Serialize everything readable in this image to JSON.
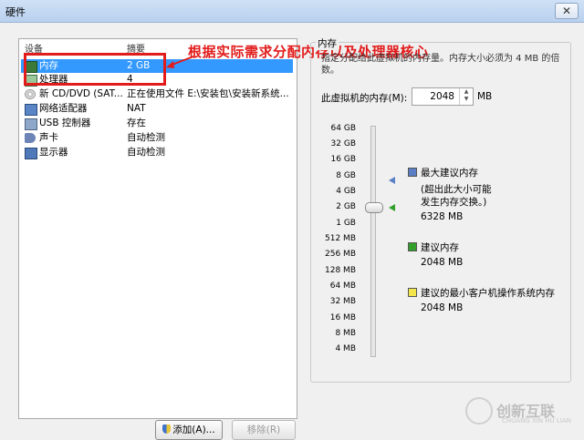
{
  "window": {
    "title": "硬件",
    "close_glyph": "✕"
  },
  "device_list": {
    "col_device": "设备",
    "col_summary": "摘要",
    "rows": [
      {
        "name": "内存",
        "summary": "2 GB"
      },
      {
        "name": "处理器",
        "summary": "4"
      },
      {
        "name": "新 CD/DVD (SAT...",
        "summary": "正在使用文件 E:\\安装包\\安装新系统..."
      },
      {
        "name": "网络适配器",
        "summary": "NAT"
      },
      {
        "name": "USB 控制器",
        "summary": "存在"
      },
      {
        "name": "声卡",
        "summary": "自动检测"
      },
      {
        "name": "显示器",
        "summary": "自动检测"
      }
    ]
  },
  "annotation": "根据实际需求分配内存以及处理器核心",
  "buttons": {
    "add": "添加(A)...",
    "remove": "移除(R)"
  },
  "memory_panel": {
    "group_label": "内存",
    "description": "指定分配给此虚拟机的内存量。内存大小必须为 4 MB 的倍数。",
    "vm_memory_label": "此虚拟机的内存(M):",
    "vm_memory_value": "2048",
    "unit": "MB",
    "scale_ticks": [
      "64 GB",
      "32 GB",
      "16 GB",
      "8 GB",
      "4 GB",
      "2 GB",
      "1 GB",
      "512 MB",
      "256 MB",
      "128 MB",
      "64 MB",
      "32 MB",
      "16 MB",
      "8 MB",
      "4 MB"
    ],
    "max_recommended": {
      "label": "最大建议内存",
      "note_line1": "(超出此大小可能",
      "note_line2": "发生内存交换。)",
      "value": "6328 MB",
      "color": "#5b7fc4"
    },
    "recommended": {
      "label": "建议内存",
      "value": "2048 MB",
      "color": "#33a02c"
    },
    "min_guest": {
      "label": "建议的最小客户机操作系统内存",
      "value": "2048 MB",
      "color": "#f2e64a"
    }
  },
  "watermark": {
    "text": "创新互联",
    "sub": "CHUANG XIN HU LIAN"
  }
}
